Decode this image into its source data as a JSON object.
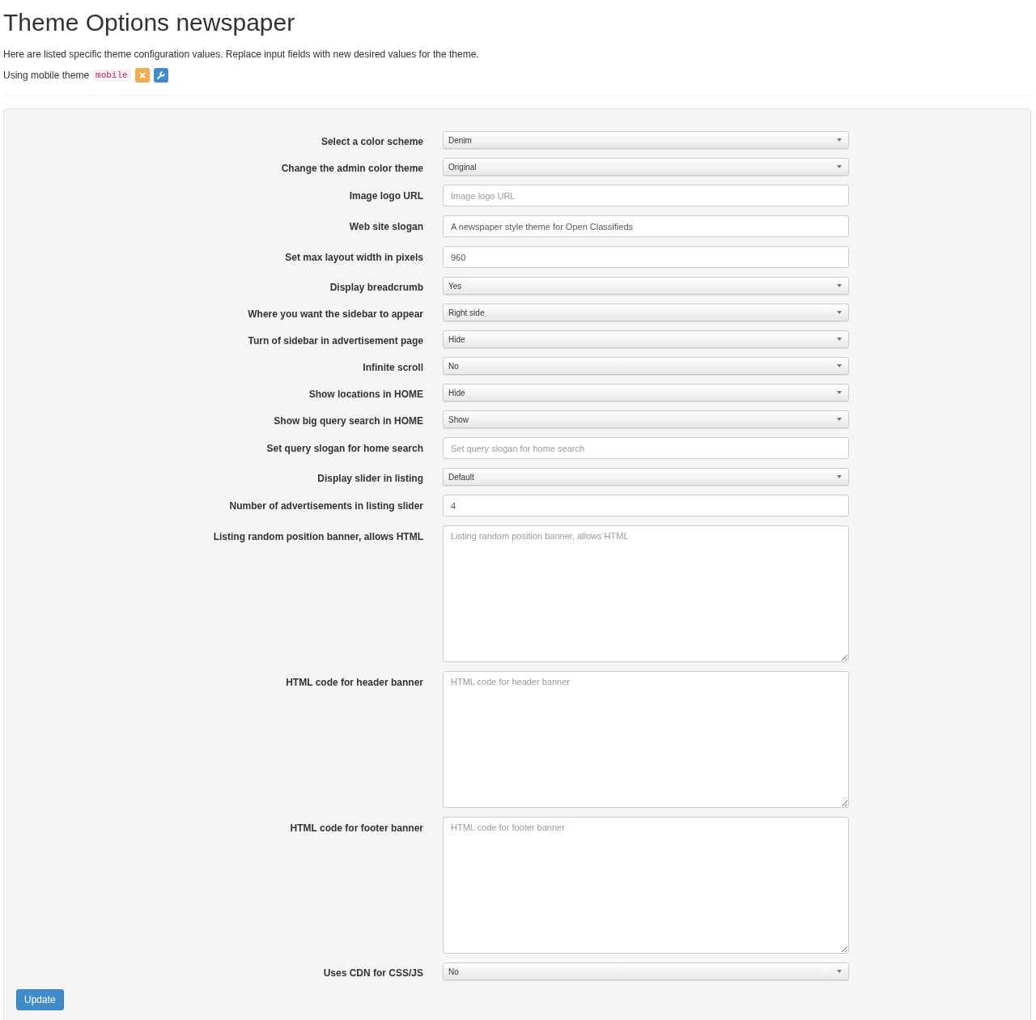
{
  "page": {
    "title": "Theme Options newspaper",
    "description": "Here are listed specific theme configuration values. Replace input fields with new desired values for the theme.",
    "mobile_label": "Using mobile theme",
    "mobile_code": "mobile"
  },
  "fields": [
    {
      "label": "Select a color scheme",
      "kind": "select",
      "value": "Denim"
    },
    {
      "label": "Change the admin color theme",
      "kind": "select",
      "value": "Original"
    },
    {
      "label": "Image logo URL",
      "kind": "input",
      "placeholder": "Image logo URL"
    },
    {
      "label": "Web site slogan",
      "kind": "input",
      "value": "A newspaper style theme for Open Classifieds"
    },
    {
      "label": "Set max layout width in pixels",
      "kind": "input",
      "value": "960"
    },
    {
      "label": "Display breadcrumb",
      "kind": "select",
      "value": "Yes"
    },
    {
      "label": "Where you want the sidebar to appear",
      "kind": "select",
      "value": "Right side"
    },
    {
      "label": "Turn of sidebar in advertisement page",
      "kind": "select",
      "value": "Hide"
    },
    {
      "label": "Infinite scroll",
      "kind": "select",
      "value": "No"
    },
    {
      "label": "Show locations in HOME",
      "kind": "select",
      "value": "Hide"
    },
    {
      "label": "Show big query search in HOME",
      "kind": "select",
      "value": "Show"
    },
    {
      "label": "Set query slogan for home search",
      "kind": "input",
      "placeholder": "Set query slogan for home search"
    },
    {
      "label": "Display slider in listing",
      "kind": "select",
      "value": "Default"
    },
    {
      "label": "Number of advertisements in listing slider",
      "kind": "input",
      "value": "4"
    },
    {
      "label": "Listing random position banner, allows HTML",
      "kind": "textarea",
      "placeholder": "Listing random position banner, allows HTML"
    },
    {
      "label": "HTML code for header banner",
      "kind": "textarea",
      "placeholder": "HTML code for header banner"
    },
    {
      "label": "HTML code for footer banner",
      "kind": "textarea",
      "placeholder": "HTML code for footer banner"
    },
    {
      "label": "Uses CDN for CSS/JS",
      "kind": "select",
      "value": "No"
    }
  ],
  "submit": "Update"
}
